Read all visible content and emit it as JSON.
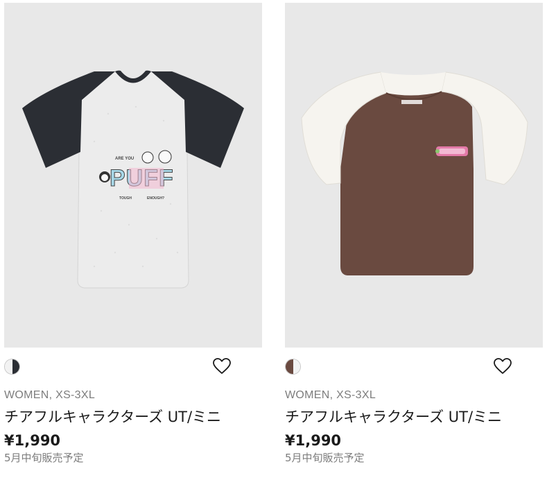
{
  "products": [
    {
      "gender_size": "WOMEN, XS-3XL",
      "title": "チアフルキャラクターズ UT/ミニ",
      "price": "¥1,990",
      "note": "5月中旬販売予定",
      "graphic_text": "PUFF",
      "graphic_small_top": "ARE YOU",
      "graphic_small_bottom_left": "TOUGH",
      "graphic_small_bottom_right": "ENOUGH?",
      "colors": {
        "body": "#efefef",
        "sleeves": "#2b2e34",
        "swatch_left": "#f2f2f2",
        "swatch_right": "#2b2e34"
      }
    },
    {
      "gender_size": "WOMEN, XS-3XL",
      "title": "チアフルキャラクターズ UT/ミニ",
      "price": "¥1,990",
      "note": "5月中旬販売予定",
      "colors": {
        "body": "#6a4a40",
        "sleeves": "#f6f4ef",
        "swatch_left": "#f2f2f2",
        "swatch_right": "#6a4a40"
      }
    }
  ]
}
